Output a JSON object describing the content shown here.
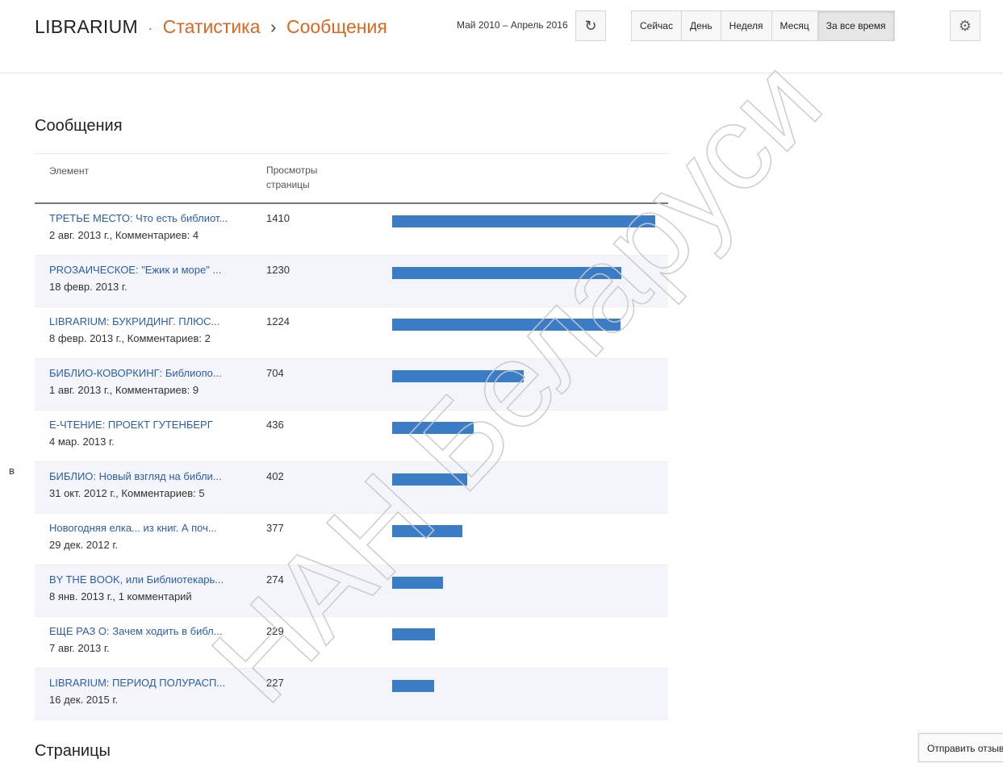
{
  "header": {
    "brand": "LIBRARIUM",
    "breadcrumb_sep": "·",
    "section": "Статистика",
    "arrow": "›",
    "page": "Сообщения",
    "date_range": "Май 2010 – Апрель 2016",
    "refresh_icon": "refresh-icon",
    "periods": [
      "Сейчас",
      "День",
      "Неделя",
      "Месяц",
      "За все время"
    ],
    "active_period": "За все время",
    "settings_icon": "gear-icon"
  },
  "posts": {
    "title": "Сообщения",
    "columns": {
      "element": "Элемент",
      "views": "Просмотры страницы"
    },
    "max_views": 1410,
    "bar_color": "#3a7dc6",
    "rows": [
      {
        "title": "ТРЕТЬЕ МЕСТО: Что есть библиот...",
        "meta": "2 авг. 2013 г., Комментариев: 4",
        "views": 1410
      },
      {
        "title": "PROЗАИЧЕСКОЕ: \"Ежик и море\" ...",
        "meta": "18 февр. 2013 г.",
        "views": 1230
      },
      {
        "title": "LIBRARIUM: БУКРИДИНГ. ПЛЮС...",
        "meta": "8 февр. 2013 г., Комментариев: 2",
        "views": 1224
      },
      {
        "title": "БИБЛИО-КОВОРКИНГ: Библиопо...",
        "meta": "1 авг. 2013 г., Комментариев: 9",
        "views": 704
      },
      {
        "title": "Е-ЧТЕНИЕ: ПРОЕКТ ГУТЕНБЕРГ",
        "meta": "4 мар. 2013 г.",
        "views": 436
      },
      {
        "title": "БИБЛИО: Новый взгляд на библи...",
        "meta": "31 окт. 2012 г., Комментариев: 5",
        "views": 402
      },
      {
        "title": "Новогодняя елка... из книг. А поч...",
        "meta": "29 дек. 2012 г.",
        "views": 377
      },
      {
        "title": "BY THE BOOK, или Библиотекарь...",
        "meta": "8 янв. 2013 г., 1 комментарий",
        "views": 274
      },
      {
        "title": "ЕЩЕ РАЗ О: Зачем ходить в библ...",
        "meta": "7 авг. 2013 г.",
        "views": 229
      },
      {
        "title": "LIBRARIUM: ПЕРИОД ПОЛУРАСП...",
        "meta": "16 дек. 2015 г.",
        "views": 227
      }
    ]
  },
  "pages_title": "Страницы",
  "stray_char": "в",
  "feedback": "Отправить отзыв",
  "watermark": "НАН Беларуси"
}
